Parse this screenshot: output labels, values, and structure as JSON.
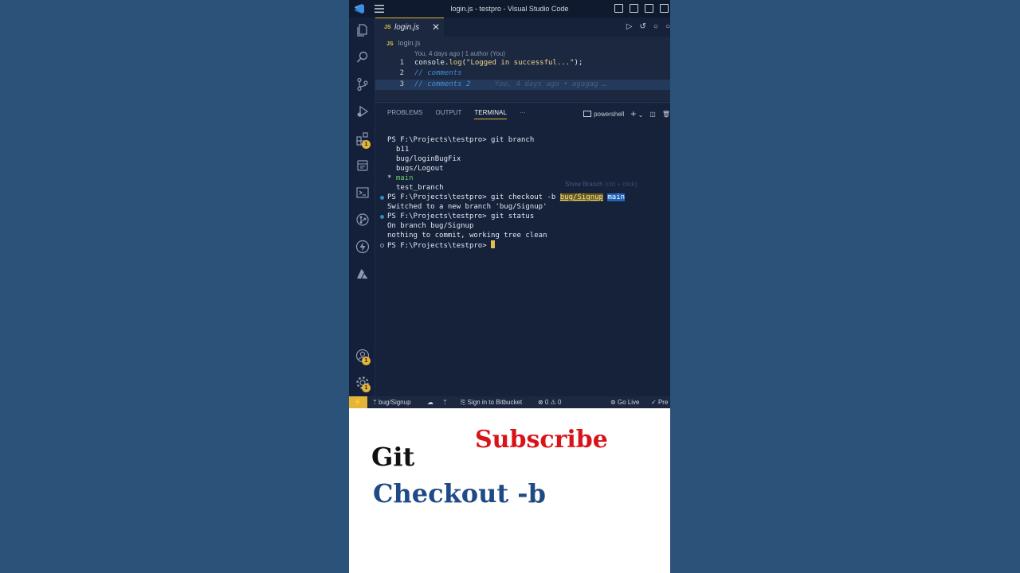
{
  "window": {
    "title": "login.js - testpro - Visual Studio Code"
  },
  "activity_bar": {
    "badges": {
      "extensions": "1",
      "accounts": "1",
      "settings": "1"
    }
  },
  "editor": {
    "tab": {
      "icon_text": "JS",
      "name": "login.js",
      "close": "✕"
    },
    "breadcrumb": {
      "icon_text": "JS",
      "file": "login.js"
    },
    "blame": "You, 4 days ago | 1 author (You)",
    "lines": [
      {
        "num": "1",
        "obj": "console",
        "dot": ".",
        "fn": "log",
        "open": "(",
        "str": "\"Logged in successful...\"",
        "close": ");"
      },
      {
        "num": "2",
        "comment": "// comments"
      },
      {
        "num": "3",
        "comment": "// comments 2",
        "ghost": "You, 4 days ago • agagag …"
      }
    ]
  },
  "panel": {
    "tabs": [
      "PROBLEMS",
      "OUTPUT",
      "TERMINAL",
      "···"
    ],
    "shell": "powershell",
    "plus": "+",
    "terminal": {
      "l1_prompt": "PS F:\\Projects\\testpro> ",
      "l1_cmd": "git branch",
      "branches": [
        "b11",
        "bug/loginBugFix",
        "bugs/Logout"
      ],
      "current_marker": "* ",
      "current_branch": "main",
      "last_branch": "test_branch",
      "l2_prompt": "PS F:\\Projects\\testpro> ",
      "l2_cmd": "git checkout",
      "l2_flag": " -b ",
      "l2_new_branch": "bug/Signup",
      "l2_base": "main",
      "l3": "Switched to a new branch 'bug/Signup'",
      "l4_prompt": "PS F:\\Projects\\testpro> ",
      "l4_cmd": "git status",
      "l5": "On branch bug/Signup",
      "l6": "nothing to commit, working tree clean",
      "l7_prompt": "PS F:\\Projects\\testpro> ",
      "hover_label": "Show Branch",
      "hover_key": " (ctrl + click)"
    }
  },
  "status_bar": {
    "branch": "bug/Signup",
    "bitbucket": "Sign in to Bitbucket",
    "problems": "⊗ 0 ⚠ 0",
    "golive": "Go Live",
    "prettier": "Pre"
  },
  "caption": {
    "line1": "Git",
    "line2": "Checkout -b",
    "subscribe": "Subscribe"
  },
  "colors": {
    "accent": "#e2b43a",
    "subscribe": "#d8141a",
    "checkout": "#1f4a86"
  }
}
